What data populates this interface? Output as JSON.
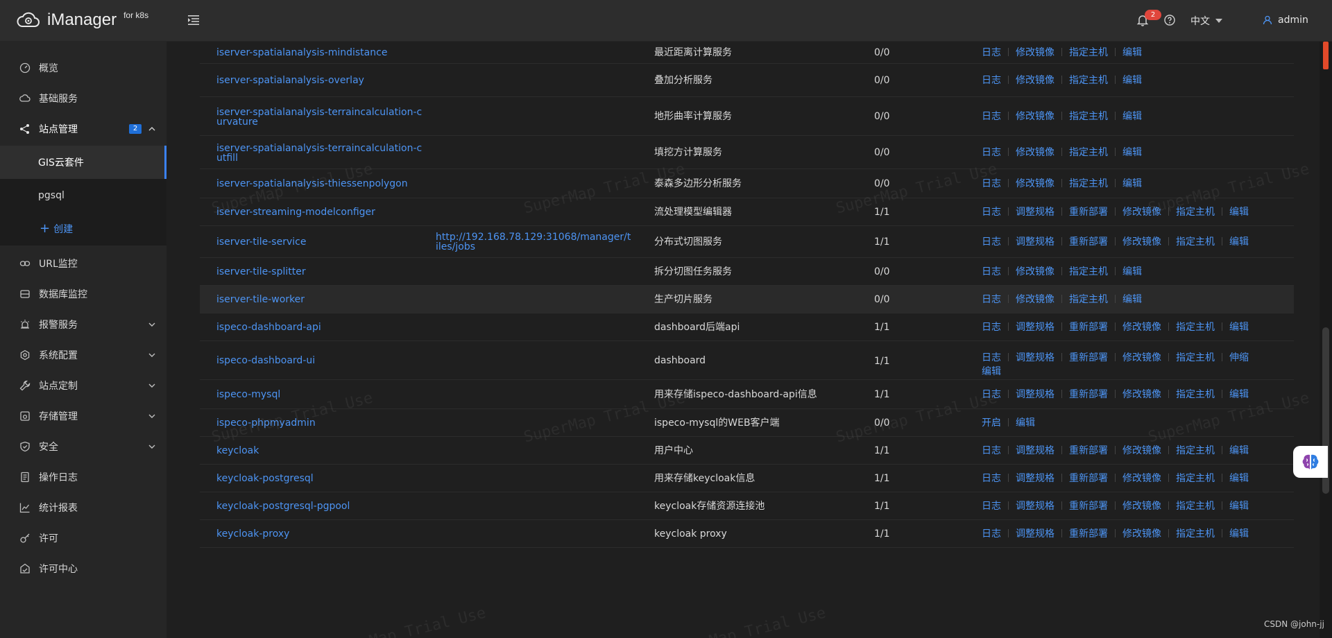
{
  "header": {
    "app_name": "iManager",
    "app_sub": "for k8s",
    "notification_count": "2",
    "language": "中文",
    "user": "admin"
  },
  "sidebar": {
    "items": [
      {
        "label": "概览",
        "icon": "dashboard-icon"
      },
      {
        "label": "基础服务",
        "icon": "cloud-icon"
      },
      {
        "label": "站点管理",
        "icon": "share-icon",
        "badge": "2",
        "expanded": true
      },
      {
        "label": "URL监控",
        "icon": "link-icon"
      },
      {
        "label": "数据库监控",
        "icon": "database-icon"
      },
      {
        "label": "报警服务",
        "icon": "alarm-icon"
      },
      {
        "label": "系统配置",
        "icon": "settings-icon"
      },
      {
        "label": "站点定制",
        "icon": "wrench-icon"
      },
      {
        "label": "存储管理",
        "icon": "storage-icon"
      },
      {
        "label": "安全",
        "icon": "shield-icon"
      },
      {
        "label": "操作日志",
        "icon": "file-icon"
      },
      {
        "label": "统计报表",
        "icon": "chart-icon"
      },
      {
        "label": "许可",
        "icon": "key-icon"
      },
      {
        "label": "许可中心",
        "icon": "license-icon"
      }
    ],
    "sub_items": {
      "active": "GIS云套件",
      "second": "pgsql",
      "create": "创建"
    }
  },
  "table": {
    "rows": [
      {
        "name": "iserver-spatialanalysis-mindistance",
        "url": "",
        "desc": "最近距离计算服务",
        "count": "0/0",
        "actions": [
          "日志",
          "修改镜像",
          "指定主机",
          "编辑"
        ]
      },
      {
        "name": "iserver-spatialanalysis-overlay",
        "url": "",
        "desc": "叠加分析服务",
        "count": "0/0",
        "actions": [
          "日志",
          "修改镜像",
          "指定主机",
          "编辑"
        ]
      },
      {
        "name": "iserver-spatialanalysis-terraincalculation-curvature",
        "url": "",
        "desc": "地形曲率计算服务",
        "count": "0/0",
        "actions": [
          "日志",
          "修改镜像",
          "指定主机",
          "编辑"
        ]
      },
      {
        "name": "iserver-spatialanalysis-terraincalculation-cutfill",
        "url": "",
        "desc": "填挖方计算服务",
        "count": "0/0",
        "actions": [
          "日志",
          "修改镜像",
          "指定主机",
          "编辑"
        ]
      },
      {
        "name": "iserver-spatialanalysis-thiessenpolygon",
        "url": "",
        "desc": "泰森多边形分析服务",
        "count": "0/0",
        "actions": [
          "日志",
          "修改镜像",
          "指定主机",
          "编辑"
        ]
      },
      {
        "name": "iserver-streaming-modelconfiger",
        "url": "",
        "desc": "流处理模型编辑器",
        "count": "1/1",
        "actions": [
          "日志",
          "调整规格",
          "重新部署",
          "修改镜像",
          "指定主机",
          "编辑"
        ]
      },
      {
        "name": "iserver-tile-service",
        "url": "http://192.168.78.129:31068/manager/tiles/jobs",
        "desc": "分布式切图服务",
        "count": "1/1",
        "actions": [
          "日志",
          "调整规格",
          "重新部署",
          "修改镜像",
          "指定主机",
          "编辑"
        ]
      },
      {
        "name": "iserver-tile-splitter",
        "url": "",
        "desc": "拆分切图任务服务",
        "count": "0/0",
        "actions": [
          "日志",
          "修改镜像",
          "指定主机",
          "编辑"
        ]
      },
      {
        "name": "iserver-tile-worker",
        "url": "",
        "desc": "生产切片服务",
        "count": "0/0",
        "actions": [
          "日志",
          "修改镜像",
          "指定主机",
          "编辑"
        ]
      },
      {
        "name": "ispeco-dashboard-api",
        "url": "",
        "desc": "dashboard后端api",
        "count": "1/1",
        "actions": [
          "日志",
          "调整规格",
          "重新部署",
          "修改镜像",
          "指定主机",
          "编辑"
        ]
      },
      {
        "name": "ispeco-dashboard-ui",
        "url": "",
        "desc": "dashboard",
        "count": "1/1",
        "actions": [
          "日志",
          "调整规格",
          "重新部署",
          "修改镜像",
          "指定主机",
          "伸缩",
          "编辑"
        ]
      },
      {
        "name": "ispeco-mysql",
        "url": "",
        "desc": "用来存储ispeco-dashboard-api信息",
        "count": "1/1",
        "actions": [
          "日志",
          "调整规格",
          "重新部署",
          "修改镜像",
          "指定主机",
          "编辑"
        ]
      },
      {
        "name": "ispeco-phpmyadmin",
        "url": "",
        "desc": "ispeco-mysql的WEB客户端",
        "count": "0/0",
        "actions": [
          "开启",
          "编辑"
        ]
      },
      {
        "name": "keycloak",
        "url": "",
        "desc": "用户中心",
        "count": "1/1",
        "actions": [
          "日志",
          "调整规格",
          "重新部署",
          "修改镜像",
          "指定主机",
          "编辑"
        ]
      },
      {
        "name": "keycloak-postgresql",
        "url": "",
        "desc": "用来存储keycloak信息",
        "count": "1/1",
        "actions": [
          "日志",
          "调整规格",
          "重新部署",
          "修改镜像",
          "指定主机",
          "编辑"
        ]
      },
      {
        "name": "keycloak-postgresql-pgpool",
        "url": "",
        "desc": "keycloak存储资源连接池",
        "count": "1/1",
        "actions": [
          "日志",
          "调整规格",
          "重新部署",
          "修改镜像",
          "指定主机",
          "编辑"
        ]
      },
      {
        "name": "keycloak-proxy",
        "url": "",
        "desc": "keycloak proxy",
        "count": "1/1",
        "actions": [
          "日志",
          "调整规格",
          "重新部署",
          "修改镜像",
          "指定主机",
          "编辑"
        ]
      }
    ]
  },
  "watermark": "SuperMap Trial Use",
  "credit": "CSDN @john-jj",
  "colors": {
    "link": "#4d94f3",
    "badge": "#e0463c",
    "active_bar": "#3b82f6"
  }
}
